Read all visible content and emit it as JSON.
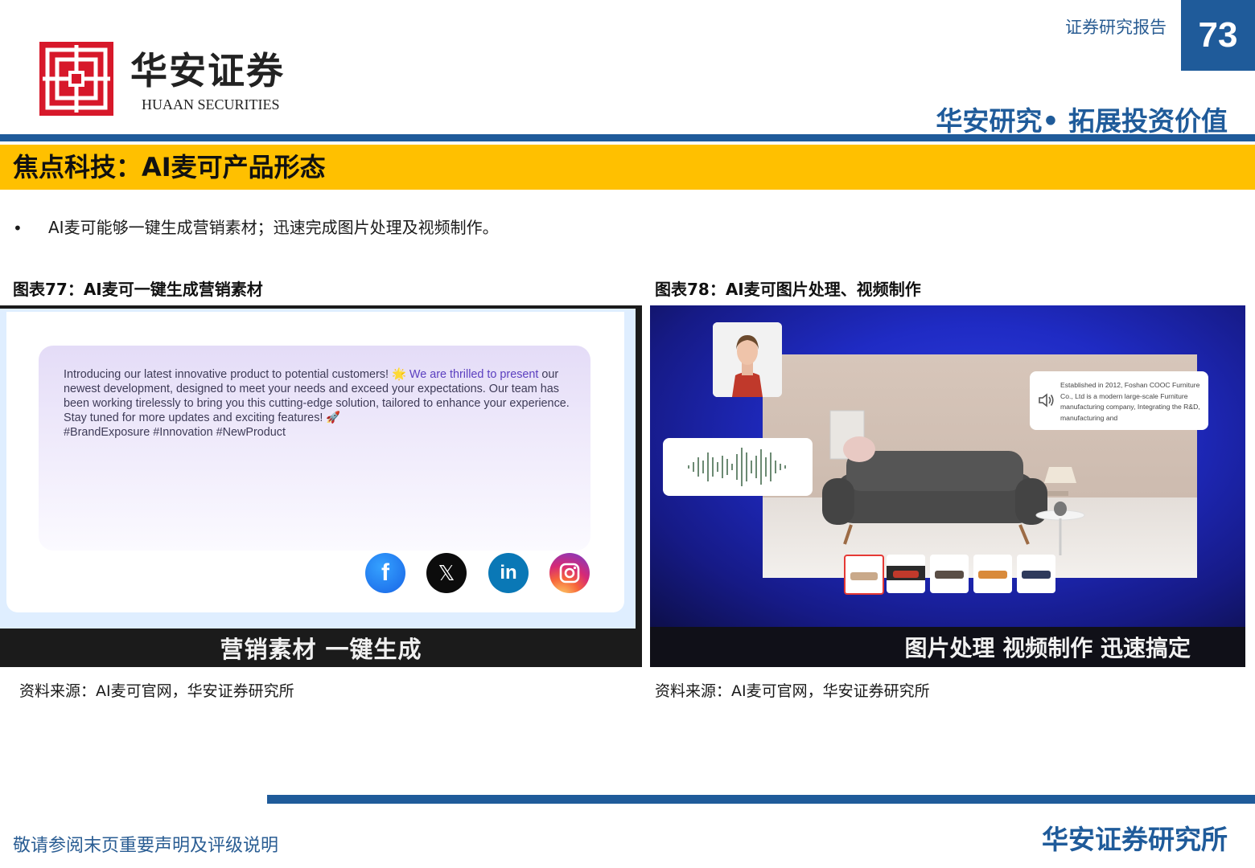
{
  "header": {
    "logo_cn": "华安证券",
    "logo_en": "HUAAN SECURITIES",
    "report_type": "证券研究报告",
    "page_number": "73",
    "slogan": "华安研究• 拓展投资价值"
  },
  "title": "焦点科技：AI麦可产品形态",
  "bullet": {
    "mark": "•",
    "text": "AI麦可能够一键生成营销素材；迅速完成图片处理及视频制作。"
  },
  "figure77": {
    "title": "图表77：AI麦可一键生成营销素材",
    "copy_lead": "Introducing our latest innovative product to potential customers! 🌟",
    "copy_highlight": "We are thrilled to present",
    "copy_rest": "our newest development, designed to meet your needs and exceed your expectations. Our team has been working tirelessly to bring you this cutting-edge solution, tailored to enhance your experience. Stay tuned for more updates and exciting features! 🚀",
    "hashtags": "#BrandExposure #Innovation #NewProduct",
    "social_icons": [
      "facebook-icon",
      "x-icon",
      "linkedin-icon",
      "instagram-icon"
    ],
    "fb_glyph": "f",
    "x_glyph": "𝕏",
    "li_glyph": "in",
    "subtitle": "营销素材 一键生成",
    "source": "资料来源：AI麦可官网，华安证券研究所"
  },
  "figure78": {
    "title": "图表78：AI麦可图片处理、视频制作",
    "info_text": "Established in 2012, Foshan COOC Furniture Co., Ltd is a modern large-scale Furniture manufacturing company, Integrating the R&D, manufacturing and",
    "subtitle": "图片处理 视频制作 迅速搞定",
    "source": "资料来源：AI麦可官网，华安证券研究所"
  },
  "footer": {
    "note": "敬请参阅末页重要声明及评级说明",
    "brand": "华安证券研究所"
  },
  "colors": {
    "brand_blue": "#1f5b9a",
    "title_bar_yellow": "#ffc000",
    "logo_red": "#d7182a"
  }
}
